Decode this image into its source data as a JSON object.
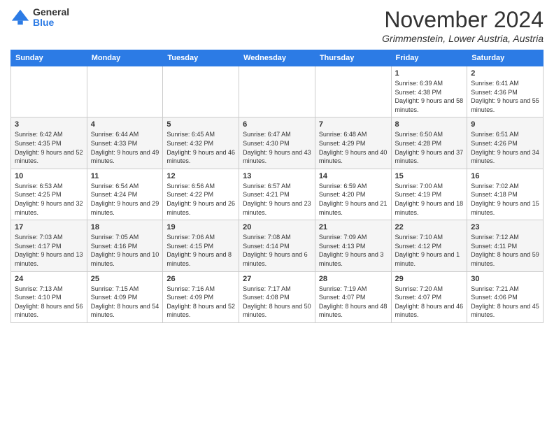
{
  "header": {
    "logo_general": "General",
    "logo_blue": "Blue",
    "title": "November 2024",
    "location": "Grimmenstein, Lower Austria, Austria"
  },
  "calendar": {
    "days_of_week": [
      "Sunday",
      "Monday",
      "Tuesday",
      "Wednesday",
      "Thursday",
      "Friday",
      "Saturday"
    ],
    "weeks": [
      [
        {
          "day": "",
          "info": ""
        },
        {
          "day": "",
          "info": ""
        },
        {
          "day": "",
          "info": ""
        },
        {
          "day": "",
          "info": ""
        },
        {
          "day": "",
          "info": ""
        },
        {
          "day": "1",
          "info": "Sunrise: 6:39 AM\nSunset: 4:38 PM\nDaylight: 9 hours and 58 minutes."
        },
        {
          "day": "2",
          "info": "Sunrise: 6:41 AM\nSunset: 4:36 PM\nDaylight: 9 hours and 55 minutes."
        }
      ],
      [
        {
          "day": "3",
          "info": "Sunrise: 6:42 AM\nSunset: 4:35 PM\nDaylight: 9 hours and 52 minutes."
        },
        {
          "day": "4",
          "info": "Sunrise: 6:44 AM\nSunset: 4:33 PM\nDaylight: 9 hours and 49 minutes."
        },
        {
          "day": "5",
          "info": "Sunrise: 6:45 AM\nSunset: 4:32 PM\nDaylight: 9 hours and 46 minutes."
        },
        {
          "day": "6",
          "info": "Sunrise: 6:47 AM\nSunset: 4:30 PM\nDaylight: 9 hours and 43 minutes."
        },
        {
          "day": "7",
          "info": "Sunrise: 6:48 AM\nSunset: 4:29 PM\nDaylight: 9 hours and 40 minutes."
        },
        {
          "day": "8",
          "info": "Sunrise: 6:50 AM\nSunset: 4:28 PM\nDaylight: 9 hours and 37 minutes."
        },
        {
          "day": "9",
          "info": "Sunrise: 6:51 AM\nSunset: 4:26 PM\nDaylight: 9 hours and 34 minutes."
        }
      ],
      [
        {
          "day": "10",
          "info": "Sunrise: 6:53 AM\nSunset: 4:25 PM\nDaylight: 9 hours and 32 minutes."
        },
        {
          "day": "11",
          "info": "Sunrise: 6:54 AM\nSunset: 4:24 PM\nDaylight: 9 hours and 29 minutes."
        },
        {
          "day": "12",
          "info": "Sunrise: 6:56 AM\nSunset: 4:22 PM\nDaylight: 9 hours and 26 minutes."
        },
        {
          "day": "13",
          "info": "Sunrise: 6:57 AM\nSunset: 4:21 PM\nDaylight: 9 hours and 23 minutes."
        },
        {
          "day": "14",
          "info": "Sunrise: 6:59 AM\nSunset: 4:20 PM\nDaylight: 9 hours and 21 minutes."
        },
        {
          "day": "15",
          "info": "Sunrise: 7:00 AM\nSunset: 4:19 PM\nDaylight: 9 hours and 18 minutes."
        },
        {
          "day": "16",
          "info": "Sunrise: 7:02 AM\nSunset: 4:18 PM\nDaylight: 9 hours and 15 minutes."
        }
      ],
      [
        {
          "day": "17",
          "info": "Sunrise: 7:03 AM\nSunset: 4:17 PM\nDaylight: 9 hours and 13 minutes."
        },
        {
          "day": "18",
          "info": "Sunrise: 7:05 AM\nSunset: 4:16 PM\nDaylight: 9 hours and 10 minutes."
        },
        {
          "day": "19",
          "info": "Sunrise: 7:06 AM\nSunset: 4:15 PM\nDaylight: 9 hours and 8 minutes."
        },
        {
          "day": "20",
          "info": "Sunrise: 7:08 AM\nSunset: 4:14 PM\nDaylight: 9 hours and 6 minutes."
        },
        {
          "day": "21",
          "info": "Sunrise: 7:09 AM\nSunset: 4:13 PM\nDaylight: 9 hours and 3 minutes."
        },
        {
          "day": "22",
          "info": "Sunrise: 7:10 AM\nSunset: 4:12 PM\nDaylight: 9 hours and 1 minute."
        },
        {
          "day": "23",
          "info": "Sunrise: 7:12 AM\nSunset: 4:11 PM\nDaylight: 8 hours and 59 minutes."
        }
      ],
      [
        {
          "day": "24",
          "info": "Sunrise: 7:13 AM\nSunset: 4:10 PM\nDaylight: 8 hours and 56 minutes."
        },
        {
          "day": "25",
          "info": "Sunrise: 7:15 AM\nSunset: 4:09 PM\nDaylight: 8 hours and 54 minutes."
        },
        {
          "day": "26",
          "info": "Sunrise: 7:16 AM\nSunset: 4:09 PM\nDaylight: 8 hours and 52 minutes."
        },
        {
          "day": "27",
          "info": "Sunrise: 7:17 AM\nSunset: 4:08 PM\nDaylight: 8 hours and 50 minutes."
        },
        {
          "day": "28",
          "info": "Sunrise: 7:19 AM\nSunset: 4:07 PM\nDaylight: 8 hours and 48 minutes."
        },
        {
          "day": "29",
          "info": "Sunrise: 7:20 AM\nSunset: 4:07 PM\nDaylight: 8 hours and 46 minutes."
        },
        {
          "day": "30",
          "info": "Sunrise: 7:21 AM\nSunset: 4:06 PM\nDaylight: 8 hours and 45 minutes."
        }
      ]
    ]
  }
}
